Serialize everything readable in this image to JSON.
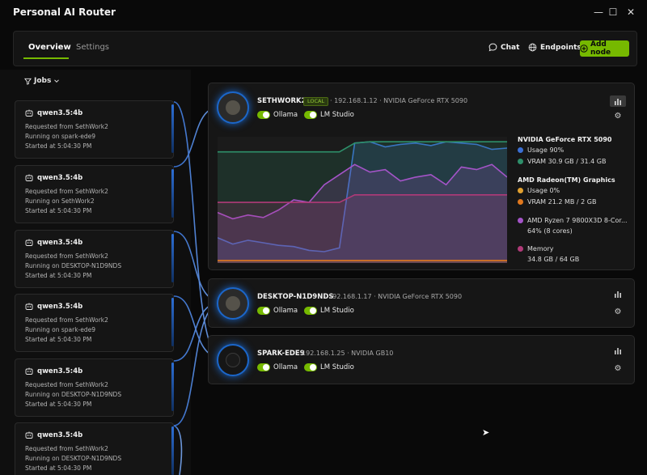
{
  "app": {
    "title": "Personal AI Router"
  },
  "window_controls": {
    "minimize": "—",
    "maximize": "☐",
    "close": "✕"
  },
  "tabs": [
    {
      "label": "Overview",
      "active": true
    },
    {
      "label": "Settings",
      "active": false
    }
  ],
  "top_buttons": {
    "chat": "Chat",
    "endpoints": "Endpoints",
    "add_node": "Add node"
  },
  "jobs": {
    "filter_label": "Jobs",
    "items": [
      {
        "model": "qwen3.5:4b",
        "requested": "Requested from SethWork2",
        "running": "Running on spark-ede9",
        "started": "Started at 5:04:30 PM"
      },
      {
        "model": "qwen3.5:4b",
        "requested": "Requested from SethWork2",
        "running": "Running on SethWork2",
        "started": "Started at 5:04:30 PM"
      },
      {
        "model": "qwen3.5:4b",
        "requested": "Requested from SethWork2",
        "running": "Running on DESKTOP-N1D9NDS",
        "started": "Started at 5:04:30 PM"
      },
      {
        "model": "qwen3.5:4b",
        "requested": "Requested from SethWork2",
        "running": "Running on spark-ede9",
        "started": "Started at 5:04:30 PM"
      },
      {
        "model": "qwen3.5:4b",
        "requested": "Requested from SethWork2",
        "running": "Running on DESKTOP-N1D9NDS",
        "started": "Started at 5:04:30 PM"
      },
      {
        "model": "qwen3.5:4b",
        "requested": "Requested from SethWork2",
        "running": "Running on DESKTOP-N1D9NDS",
        "started": "Started at 5:04:30 PM"
      }
    ]
  },
  "nodes": [
    {
      "name": "SETHWORK2",
      "badge": "LOCAL",
      "ip": "192.168.1.12",
      "gpu": "NVIDIA GeForce RTX 5090",
      "services": [
        "Ollama",
        "LM Studio"
      ]
    },
    {
      "name": "DESKTOP-N1D9NDS",
      "ip": "192.168.1.17",
      "gpu": "NVIDIA GeForce RTX 5090",
      "services": [
        "Ollama",
        "LM Studio"
      ]
    },
    {
      "name": "SPARK-EDE9",
      "ip": "192.168.1.25",
      "gpu": "NVIDIA GB10",
      "services": [
        "Ollama",
        "LM Studio"
      ]
    }
  ],
  "legend": {
    "gpu1": {
      "title": "NVIDIA GeForce RTX 5090",
      "usage": "Usage  90%",
      "vram": "VRAM  30.9 GB / 31.4 GB"
    },
    "gpu2": {
      "title": "AMD Radeon(TM) Graphics",
      "usage": "Usage  0%",
      "vram": "VRAM  21.2 MB / 2 GB"
    },
    "cpu": {
      "title": "AMD Ryzen 7 9800X3D 8-Cor...",
      "detail": "64% (8 cores)"
    },
    "memory": {
      "title": "Memory",
      "detail": "34.8 GB / 64 GB"
    }
  },
  "colors": {
    "accent": "#76b900",
    "gpu_usage": "#3b6fd4",
    "vram": "#2e8f6a",
    "gpu2_usage": "#e0a030",
    "gpu2_vram": "#e0781e",
    "cpu": "#a454c8",
    "memory": "#b03a78"
  },
  "chart_data": {
    "type": "area",
    "series": [
      {
        "name": "Usage",
        "color": "#3b6fd4",
        "values": [
          20,
          15,
          18,
          16,
          14,
          13,
          10,
          9,
          12,
          95,
          96,
          92,
          94,
          95,
          93,
          96,
          95,
          94,
          90,
          91
        ]
      },
      {
        "name": "VRAM",
        "color": "#2e8f6a",
        "values": [
          88,
          88,
          88,
          88,
          88,
          88,
          88,
          88,
          88,
          95,
          96,
          96,
          96,
          96,
          96,
          96,
          96,
          96,
          96,
          96
        ]
      },
      {
        "name": "AMD Ryzen 7 9800X3D 8-Cor...",
        "color": "#a454c8",
        "values": [
          40,
          35,
          38,
          36,
          42,
          50,
          48,
          62,
          70,
          78,
          72,
          74,
          65,
          68,
          70,
          62,
          76,
          74,
          78,
          68
        ]
      },
      {
        "name": "Memory",
        "color": "#b03a78",
        "values": [
          48,
          48,
          48,
          48,
          48,
          48,
          48,
          48,
          48,
          54,
          54,
          54,
          54,
          54,
          54,
          54,
          54,
          54,
          54,
          54
        ]
      },
      {
        "name": "Usage",
        "color": "#e0781e",
        "values": [
          2,
          2,
          2,
          2,
          2,
          2,
          2,
          2,
          2,
          2,
          2,
          2,
          2,
          2,
          2,
          2,
          2,
          2,
          2,
          2
        ]
      }
    ],
    "ylim": [
      0,
      100
    ]
  }
}
